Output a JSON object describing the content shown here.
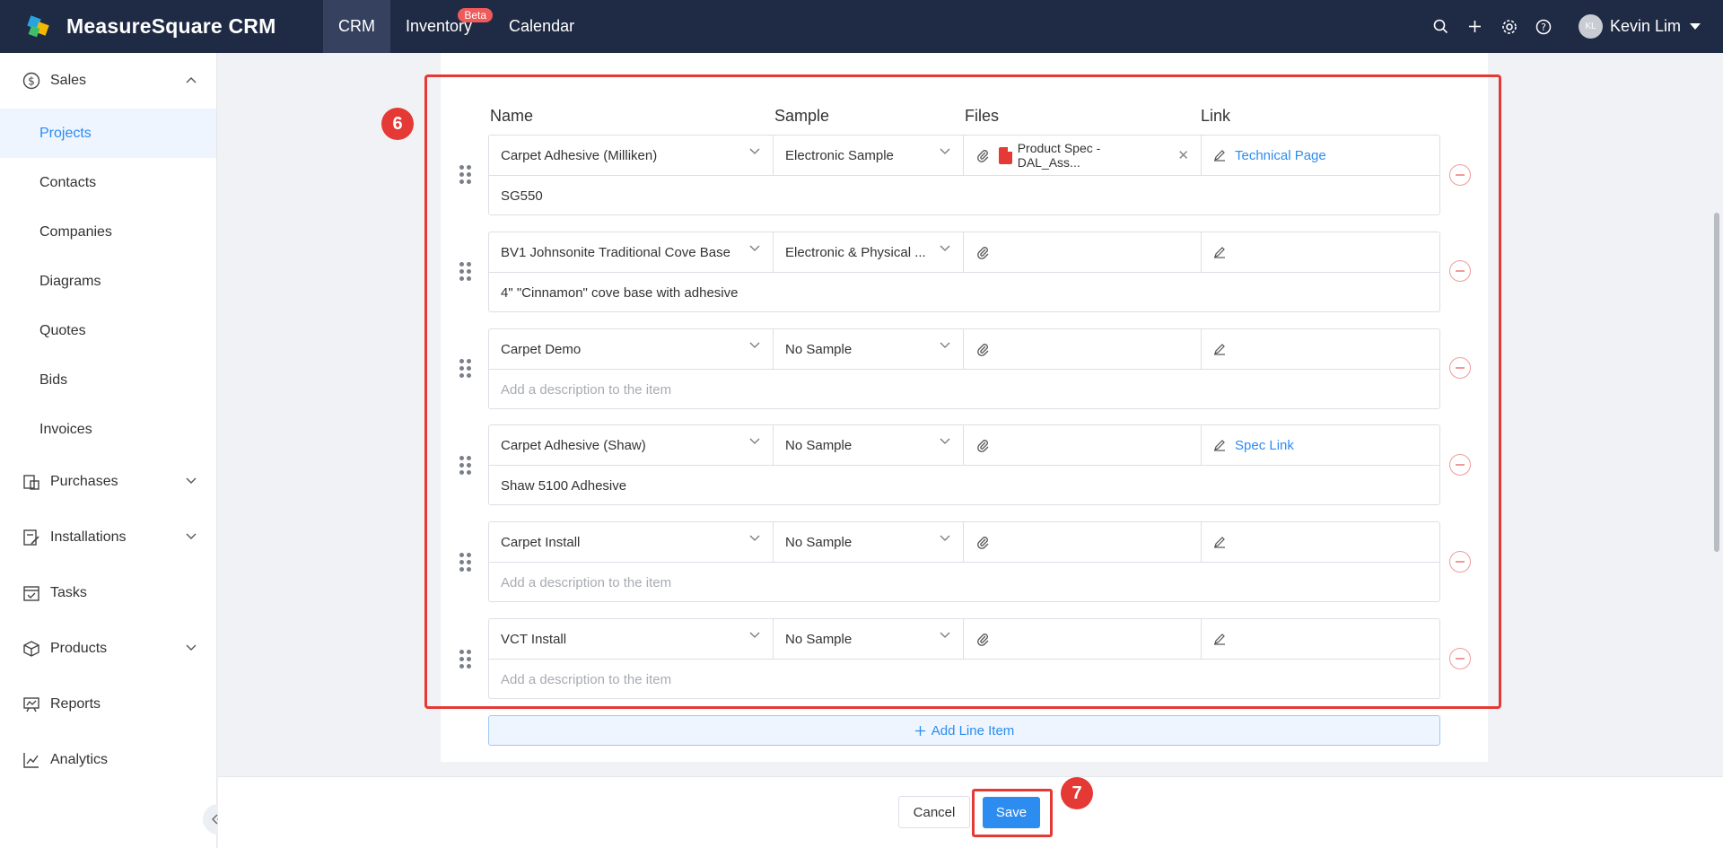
{
  "app": {
    "name": "MeasureSquare CRM",
    "nav": [
      {
        "label": "CRM",
        "active": true
      },
      {
        "label": "Inventory",
        "badge": "Beta"
      },
      {
        "label": "Calendar"
      }
    ],
    "user": {
      "initials": "KL",
      "name": "Kevin Lim"
    },
    "icons": [
      "search-icon",
      "plus-icon",
      "gear-icon",
      "help-icon"
    ]
  },
  "sidebar": {
    "sales": {
      "label": "Sales",
      "icon": "dollar-icon"
    },
    "sales_items": [
      "Projects",
      "Contacts",
      "Companies",
      "Diagrams",
      "Quotes",
      "Bids",
      "Invoices"
    ],
    "active_item": "Projects",
    "groups": [
      {
        "label": "Purchases",
        "icon": "purchases-icon",
        "expandable": true
      },
      {
        "label": "Installations",
        "icon": "installations-icon",
        "expandable": true
      },
      {
        "label": "Tasks",
        "icon": "tasks-icon",
        "expandable": false
      },
      {
        "label": "Products",
        "icon": "box-icon",
        "expandable": true
      },
      {
        "label": "Reports",
        "icon": "reports-icon",
        "expandable": false
      },
      {
        "label": "Analytics",
        "icon": "analytics-icon",
        "expandable": false
      }
    ]
  },
  "line_items": {
    "headers": {
      "name": "Name",
      "sample": "Sample",
      "files": "Files",
      "link": "Link"
    },
    "desc_placeholder": "Add a description to the item",
    "items": [
      {
        "name": "Carpet Adhesive (Milliken)",
        "sample": "Electronic Sample",
        "file": "Product Spec - DAL_Ass...",
        "link": "Technical Page",
        "description": "SG550"
      },
      {
        "name": "BV1 Johnsonite Traditional Cove Base",
        "sample": "Electronic & Physical ...",
        "file": "",
        "link": "",
        "description": "4\" \"Cinnamon\" cove base with adhesive"
      },
      {
        "name": "Carpet Demo",
        "sample": "No Sample",
        "file": "",
        "link": "",
        "description": ""
      },
      {
        "name": "Carpet Adhesive (Shaw)",
        "sample": "No Sample",
        "file": "",
        "link": "Spec Link",
        "description": "Shaw 5100 Adhesive"
      },
      {
        "name": "Carpet Install",
        "sample": "No Sample",
        "file": "",
        "link": "",
        "description": ""
      },
      {
        "name": "VCT Install",
        "sample": "No Sample",
        "file": "",
        "link": "",
        "description": ""
      }
    ],
    "add_label": "Add Line Item"
  },
  "steps": {
    "six": "6",
    "seven": "7"
  },
  "footer": {
    "cancel": "Cancel",
    "save": "Save"
  },
  "colors": {
    "topbar": "#1f2a44",
    "accent": "#2d8cf0",
    "annotation": "#e53935"
  }
}
